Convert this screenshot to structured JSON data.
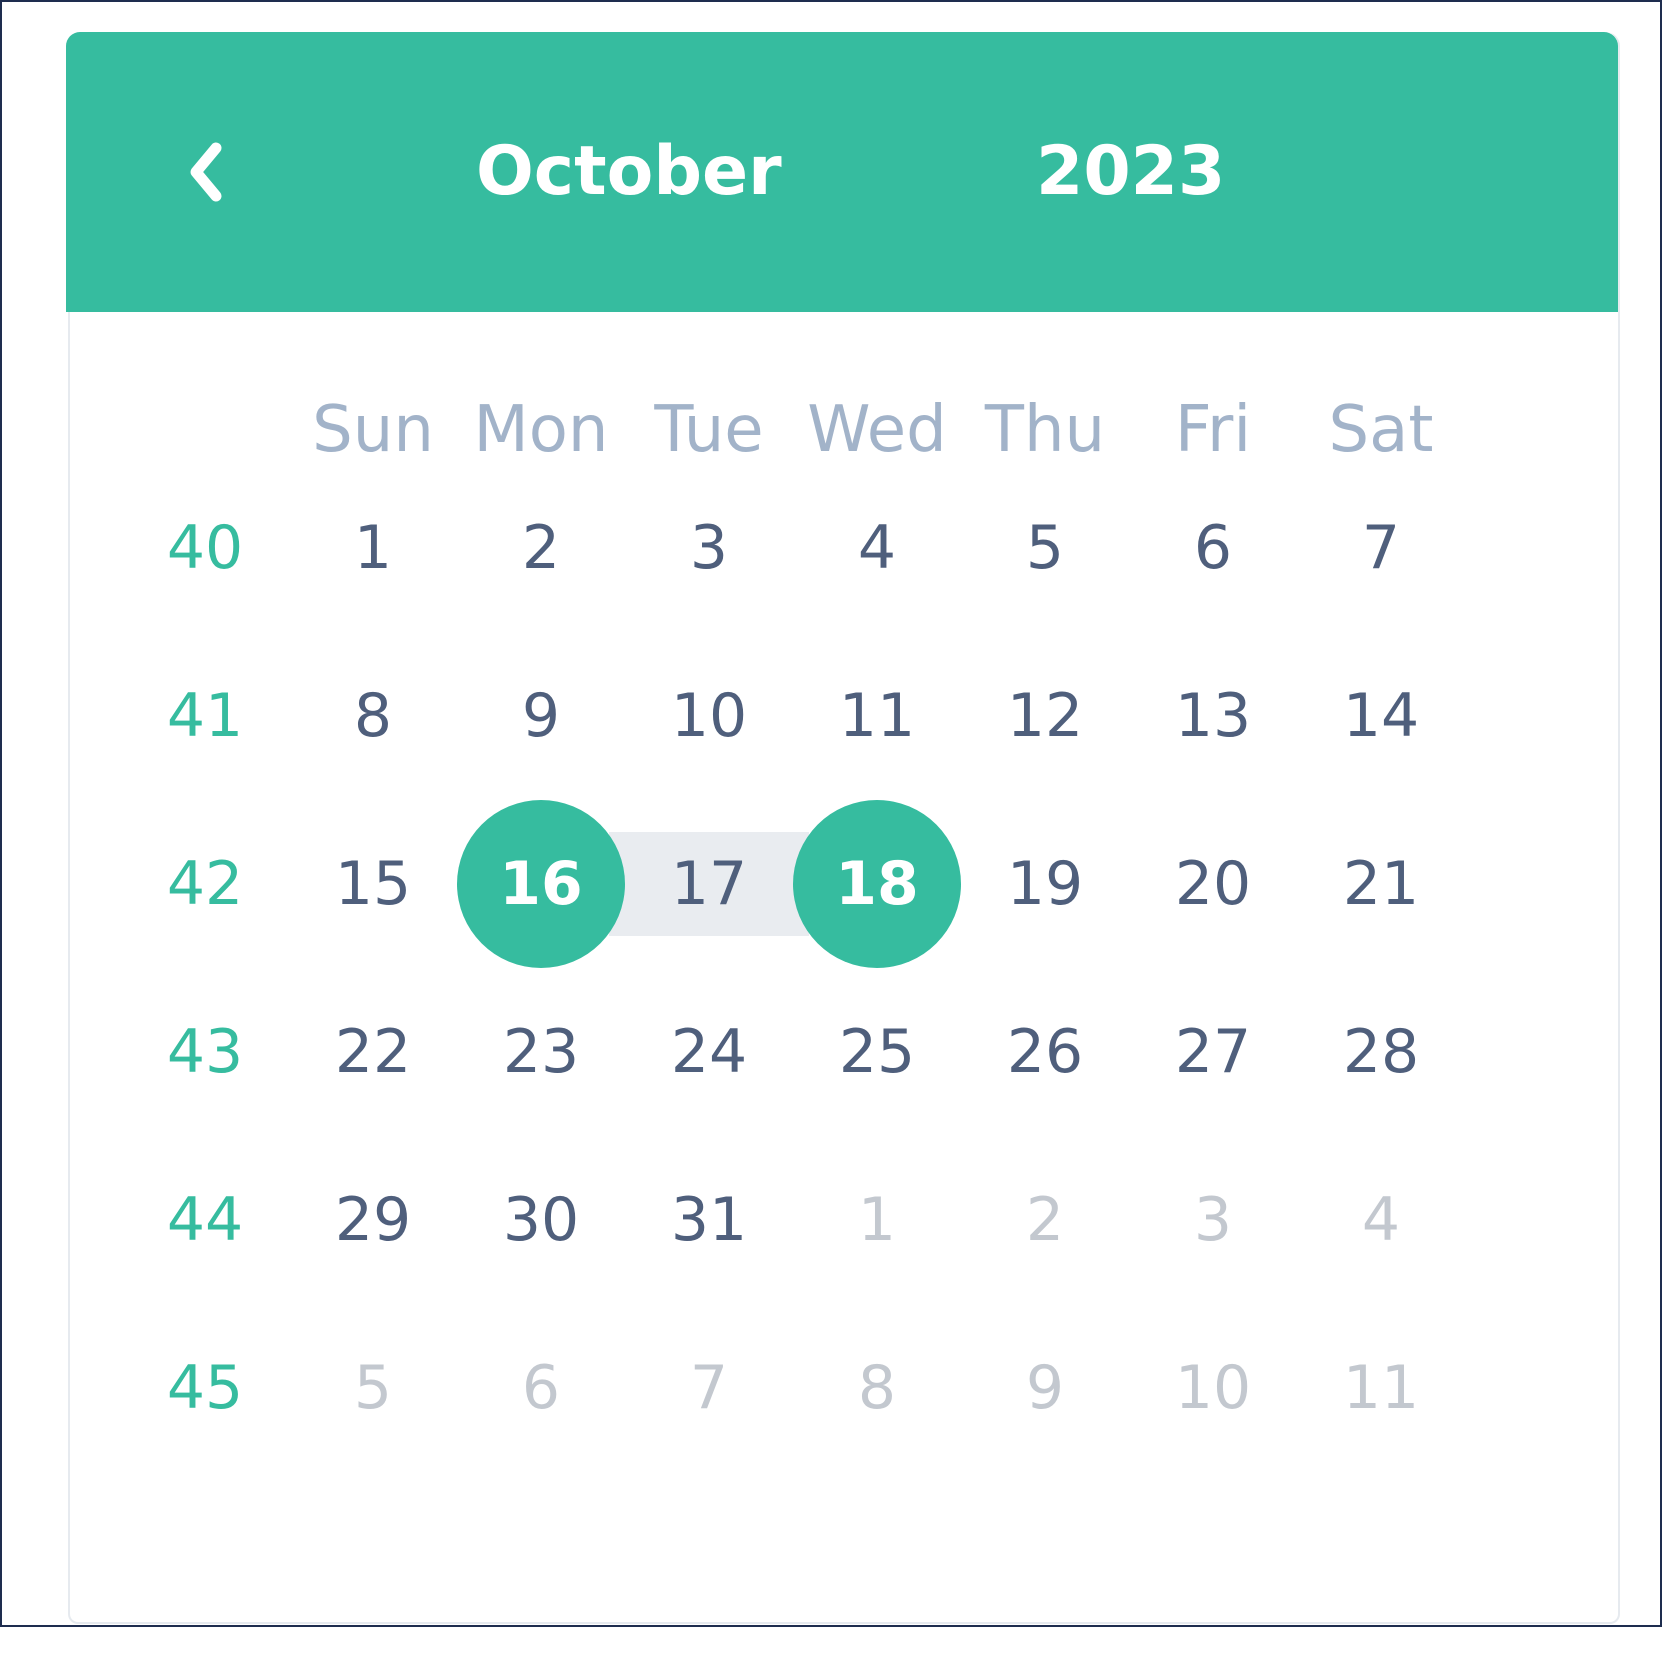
{
  "header": {
    "prev_icon": "chevron-left-icon",
    "month": "October",
    "year": "2023"
  },
  "colors": {
    "accent": "#36bc9f",
    "range": "#e9ecf0",
    "day_text": "#4f5f7c",
    "weekday_text": "#a2b3c9",
    "outside_text": "#c3c8cf",
    "frame": "#1e2d4f"
  },
  "weekdays": [
    "Sun",
    "Mon",
    "Tue",
    "Wed",
    "Thu",
    "Fri",
    "Sat"
  ],
  "weeks": [
    {
      "number": "40",
      "days": [
        {
          "label": "1"
        },
        {
          "label": "2"
        },
        {
          "label": "3"
        },
        {
          "label": "4"
        },
        {
          "label": "5"
        },
        {
          "label": "6"
        },
        {
          "label": "7"
        }
      ]
    },
    {
      "number": "41",
      "days": [
        {
          "label": "8"
        },
        {
          "label": "9"
        },
        {
          "label": "10"
        },
        {
          "label": "11"
        },
        {
          "label": "12"
        },
        {
          "label": "13"
        },
        {
          "label": "14"
        }
      ]
    },
    {
      "number": "42",
      "days": [
        {
          "label": "15"
        },
        {
          "label": "16",
          "state": "range-start"
        },
        {
          "label": "17",
          "state": "in-range"
        },
        {
          "label": "18",
          "state": "range-end"
        },
        {
          "label": "19"
        },
        {
          "label": "20"
        },
        {
          "label": "21"
        }
      ]
    },
    {
      "number": "43",
      "days": [
        {
          "label": "22"
        },
        {
          "label": "23"
        },
        {
          "label": "24"
        },
        {
          "label": "25"
        },
        {
          "label": "26"
        },
        {
          "label": "27"
        },
        {
          "label": "28"
        }
      ]
    },
    {
      "number": "44",
      "days": [
        {
          "label": "29"
        },
        {
          "label": "30"
        },
        {
          "label": "31"
        },
        {
          "label": "1",
          "state": "outside"
        },
        {
          "label": "2",
          "state": "outside"
        },
        {
          "label": "3",
          "state": "outside"
        },
        {
          "label": "4",
          "state": "outside"
        }
      ]
    },
    {
      "number": "45",
      "days": [
        {
          "label": "5",
          "state": "outside"
        },
        {
          "label": "6",
          "state": "outside"
        },
        {
          "label": "7",
          "state": "outside"
        },
        {
          "label": "8",
          "state": "outside"
        },
        {
          "label": "9",
          "state": "outside"
        },
        {
          "label": "10",
          "state": "outside"
        },
        {
          "label": "11",
          "state": "outside"
        }
      ]
    }
  ]
}
